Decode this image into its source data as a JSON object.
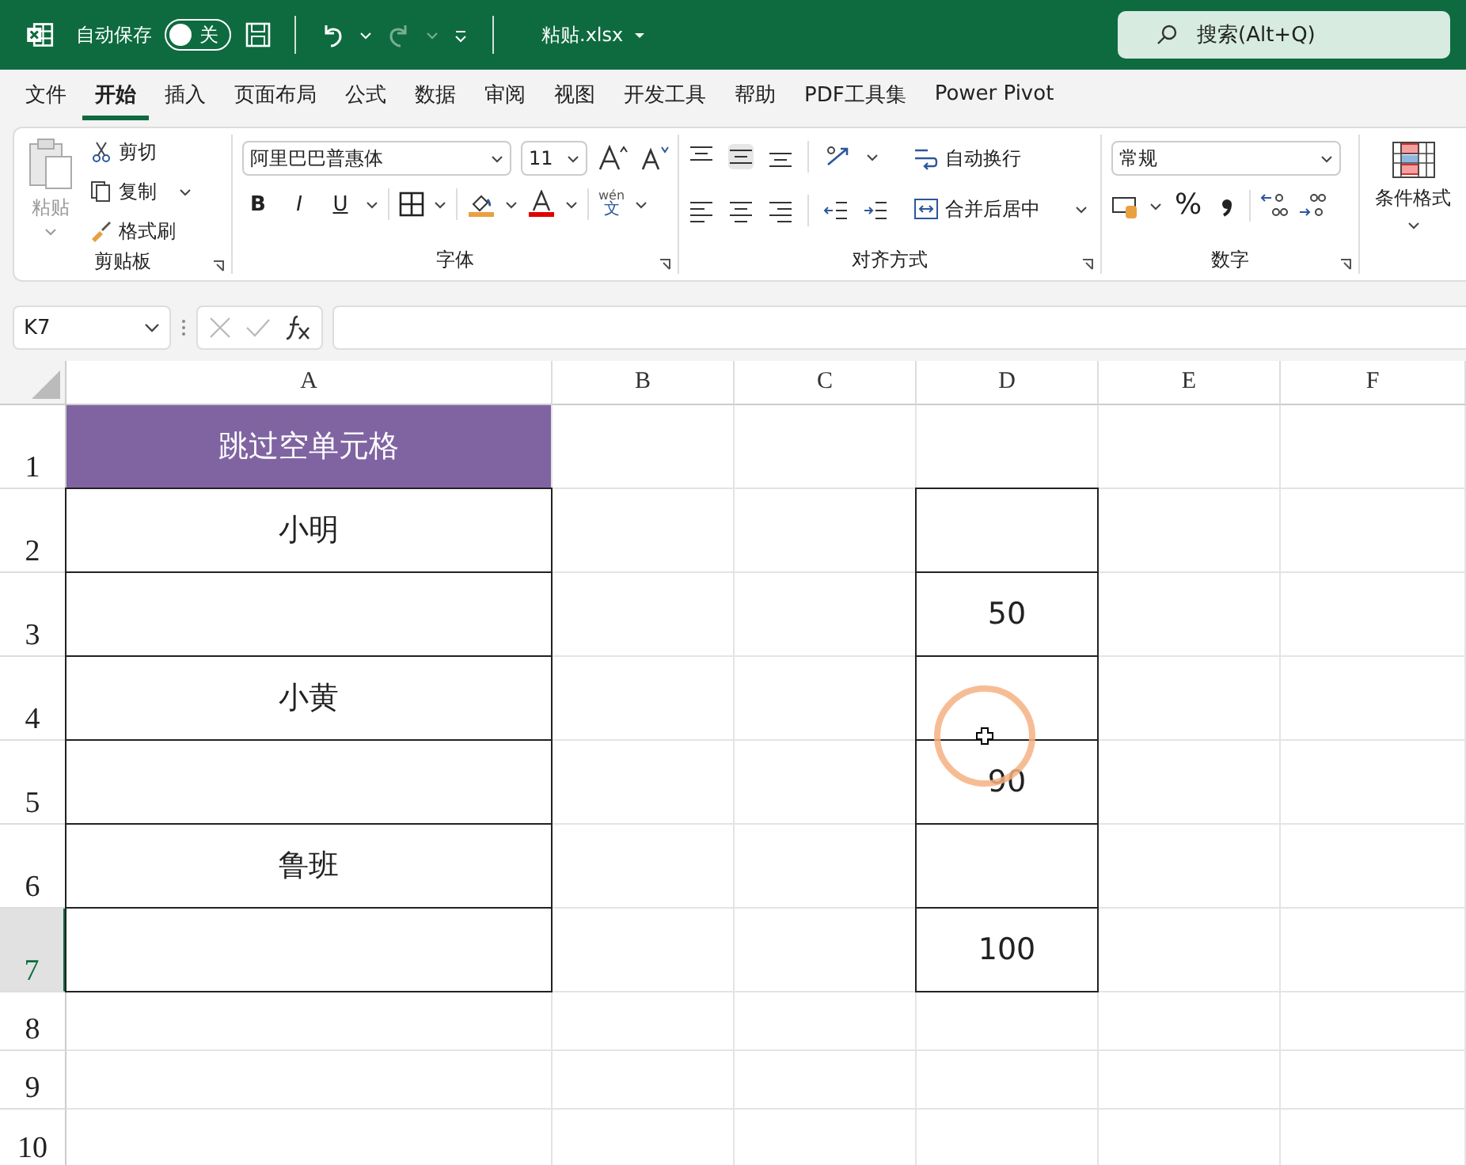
{
  "title_bar": {
    "autosave_label": "自动保存",
    "autosave_toggle": {
      "on": false,
      "label": "关"
    },
    "filename": "粘贴.xlsx",
    "search_placeholder": "搜索(Alt+Q)"
  },
  "tabs": [
    {
      "label": "文件",
      "selected": false
    },
    {
      "label": "开始",
      "selected": true
    },
    {
      "label": "插入",
      "selected": false
    },
    {
      "label": "页面布局",
      "selected": false
    },
    {
      "label": "公式",
      "selected": false
    },
    {
      "label": "数据",
      "selected": false
    },
    {
      "label": "审阅",
      "selected": false
    },
    {
      "label": "视图",
      "selected": false
    },
    {
      "label": "开发工具",
      "selected": false
    },
    {
      "label": "帮助",
      "selected": false
    },
    {
      "label": "PDF工具集",
      "selected": false
    },
    {
      "label": "Power Pivot",
      "selected": false
    }
  ],
  "ribbon": {
    "clipboard": {
      "paste": "粘贴",
      "cut": "剪切",
      "copy": "复制",
      "format_painter": "格式刷",
      "title": "剪贴板"
    },
    "font": {
      "font_name": "阿里巴巴普惠体",
      "font_size": "11",
      "bold": "B",
      "italic": "I",
      "underline": "U",
      "phonetic_top": "wén",
      "phonetic_bottom": "文",
      "title": "字体"
    },
    "alignment": {
      "wrap_text": "自动换行",
      "merge_center": "合并后居中",
      "title": "对齐方式"
    },
    "number": {
      "format": "常规",
      "percent": "%",
      "title": "数字"
    },
    "styles": {
      "conditional_formatting": "条件格式"
    }
  },
  "formula_bar": {
    "name_box": "K7"
  },
  "sheet": {
    "columns": [
      {
        "label": "A",
        "selected": false
      },
      {
        "label": "B",
        "selected": false
      },
      {
        "label": "C",
        "selected": false
      },
      {
        "label": "D",
        "selected": false
      },
      {
        "label": "E",
        "selected": false
      },
      {
        "label": "F",
        "selected": false
      }
    ],
    "rows": [
      {
        "number": "1",
        "selected": false,
        "cells": [
          {
            "kind": "title",
            "text": "跳过空单元格"
          },
          {
            "kind": "plain"
          },
          {
            "kind": "plain"
          },
          {
            "kind": "plain"
          },
          {
            "kind": "plain"
          },
          {
            "kind": "plain"
          }
        ]
      },
      {
        "number": "2",
        "selected": false,
        "cells": [
          {
            "kind": "boxed",
            "text": "小明"
          },
          {
            "kind": "plain"
          },
          {
            "kind": "plain"
          },
          {
            "kind": "boxed"
          },
          {
            "kind": "plain"
          },
          {
            "kind": "plain"
          }
        ]
      },
      {
        "number": "3",
        "selected": false,
        "cells": [
          {
            "kind": "boxed"
          },
          {
            "kind": "plain"
          },
          {
            "kind": "plain"
          },
          {
            "kind": "boxed",
            "text": "50"
          },
          {
            "kind": "plain"
          },
          {
            "kind": "plain"
          }
        ]
      },
      {
        "number": "4",
        "selected": false,
        "cells": [
          {
            "kind": "boxed",
            "text": "小黄"
          },
          {
            "kind": "plain"
          },
          {
            "kind": "plain"
          },
          {
            "kind": "boxed"
          },
          {
            "kind": "plain"
          },
          {
            "kind": "plain"
          }
        ]
      },
      {
        "number": "5",
        "selected": false,
        "cells": [
          {
            "kind": "boxed"
          },
          {
            "kind": "plain"
          },
          {
            "kind": "plain"
          },
          {
            "kind": "boxed",
            "text": "90"
          },
          {
            "kind": "plain"
          },
          {
            "kind": "plain"
          }
        ]
      },
      {
        "number": "6",
        "selected": false,
        "cells": [
          {
            "kind": "boxed",
            "text": "鲁班"
          },
          {
            "kind": "plain"
          },
          {
            "kind": "plain"
          },
          {
            "kind": "boxed"
          },
          {
            "kind": "plain"
          },
          {
            "kind": "plain"
          }
        ]
      },
      {
        "number": "7",
        "selected": true,
        "cells": [
          {
            "kind": "boxed"
          },
          {
            "kind": "plain"
          },
          {
            "kind": "plain"
          },
          {
            "kind": "boxed",
            "text": "100"
          },
          {
            "kind": "plain"
          },
          {
            "kind": "plain"
          }
        ]
      },
      {
        "number": "8",
        "selected": false,
        "cells": [
          {
            "kind": "plain"
          },
          {
            "kind": "plain"
          },
          {
            "kind": "plain"
          },
          {
            "kind": "plain"
          },
          {
            "kind": "plain"
          },
          {
            "kind": "plain"
          }
        ]
      },
      {
        "number": "9",
        "selected": false,
        "cells": [
          {
            "kind": "plain"
          },
          {
            "kind": "plain"
          },
          {
            "kind": "plain"
          },
          {
            "kind": "plain"
          },
          {
            "kind": "plain"
          },
          {
            "kind": "plain"
          }
        ]
      },
      {
        "number": "10",
        "selected": false,
        "cells": [
          {
            "kind": "plain"
          },
          {
            "kind": "plain"
          },
          {
            "kind": "plain"
          },
          {
            "kind": "plain"
          },
          {
            "kind": "plain"
          },
          {
            "kind": "plain"
          }
        ]
      }
    ]
  }
}
